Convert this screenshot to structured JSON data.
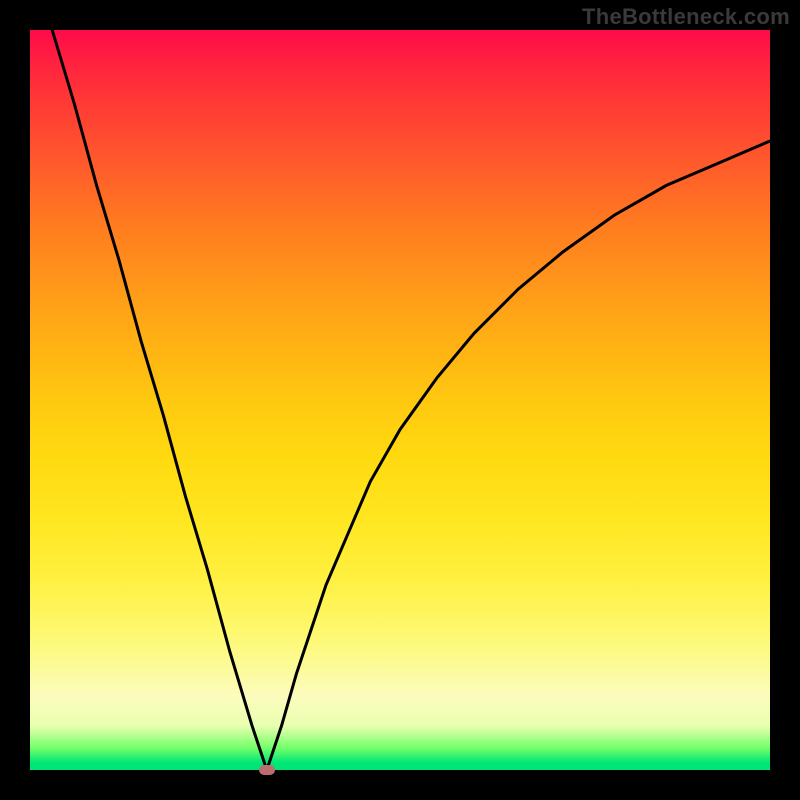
{
  "watermark": "TheBottleneck.com",
  "chart_data": {
    "type": "line",
    "title": "",
    "xlabel": "",
    "ylabel": "",
    "xlim": [
      0,
      100
    ],
    "ylim": [
      0,
      100
    ],
    "background_gradient": {
      "top": "#ff0a4a",
      "bottom": "#00e676",
      "meaning": "color encodes value height (red=high, green=low)"
    },
    "series": [
      {
        "name": "left-segment",
        "x": [
          3,
          6,
          9,
          12,
          15,
          18,
          21,
          24,
          27,
          30,
          32
        ],
        "values": [
          100,
          90,
          79,
          69,
          58,
          48,
          37,
          27,
          16,
          6,
          0
        ]
      },
      {
        "name": "right-segment",
        "x": [
          32,
          34,
          36,
          38,
          40,
          43,
          46,
          50,
          55,
          60,
          66,
          72,
          79,
          86,
          93,
          100
        ],
        "values": [
          0,
          6,
          13,
          19,
          25,
          32,
          39,
          46,
          53,
          59,
          65,
          70,
          75,
          79,
          82,
          85
        ]
      }
    ],
    "marker": {
      "x": 32,
      "y": 0,
      "name": "bottleneck-point",
      "color": "#bd6d6d"
    }
  },
  "colors": {
    "frame": "#000000",
    "curve": "#000000",
    "marker": "#bd6d6d",
    "watermark": "#3a3a3a"
  }
}
